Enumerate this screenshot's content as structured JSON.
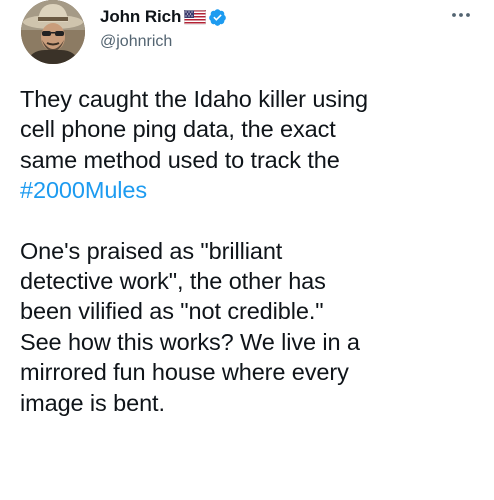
{
  "author": {
    "display_name": "John Rich",
    "handle": "@johnrich",
    "flag": "us-flag-emoji",
    "verified_badge": "verified-icon",
    "avatar": "avatar-icon"
  },
  "menu": {
    "more_icon": "more-icon"
  },
  "tweet": {
    "para1_lines": [
      "They caught the Idaho killer using",
      "cell phone ping data, the exact",
      "same method used to track the"
    ],
    "hashtag": "#2000Mules",
    "para2_lines": [
      "One's praised as \"brilliant",
      "detective work\", the other has",
      "been vilified as \"not credible.\"",
      "See how this works? We live in a",
      "mirrored fun house where every",
      "image is bent."
    ]
  },
  "colors": {
    "text": "#0f1419",
    "secondary": "#536471",
    "link": "#1d9bf0",
    "verified": "#1d9bf0"
  }
}
